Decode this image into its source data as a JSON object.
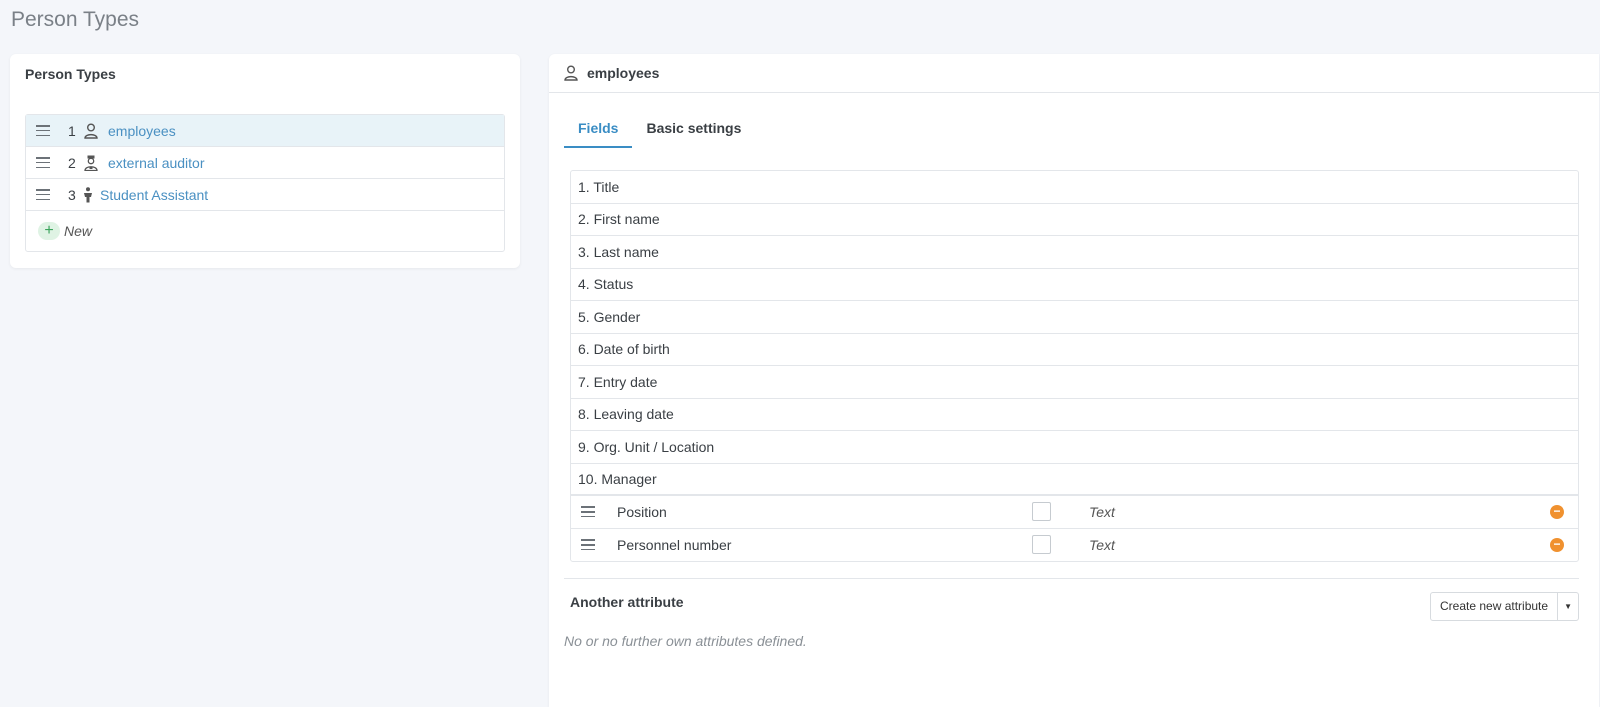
{
  "page": {
    "title": "Person Types"
  },
  "left_panel": {
    "title": "Person Types",
    "items": [
      {
        "number": "1",
        "icon": "person-outline-icon",
        "label": "employees",
        "active": true
      },
      {
        "number": "2",
        "icon": "person-badge-icon",
        "label": "external auditor",
        "active": false
      },
      {
        "number": "3",
        "icon": "person-standing-icon",
        "label": "Student Assistant",
        "active": false
      }
    ],
    "new_label": "New"
  },
  "right_panel": {
    "header": "employees",
    "tabs": [
      {
        "label": "Fields",
        "active": true
      },
      {
        "label": "Basic settings",
        "active": false
      }
    ],
    "fixed_fields": [
      "1. Title",
      "2. First name",
      "3. Last name",
      "4. Status",
      "5. Gender",
      "6. Date of birth",
      "7. Entry date",
      "8. Leaving date",
      "9. Org. Unit / Location",
      "10. Manager"
    ],
    "attributes": [
      {
        "name": "Position",
        "type": "Text",
        "checked": false
      },
      {
        "name": "Personnel number",
        "type": "Text",
        "checked": false
      }
    ],
    "another_attribute": {
      "title": "Another attribute",
      "create_button": "Create new attribute",
      "empty_note": "No or no further own attributes defined."
    }
  },
  "colors": {
    "accent": "#3a8dc4",
    "link": "#4a90c2",
    "remove": "#f0912f",
    "add": "#3aa35b"
  }
}
